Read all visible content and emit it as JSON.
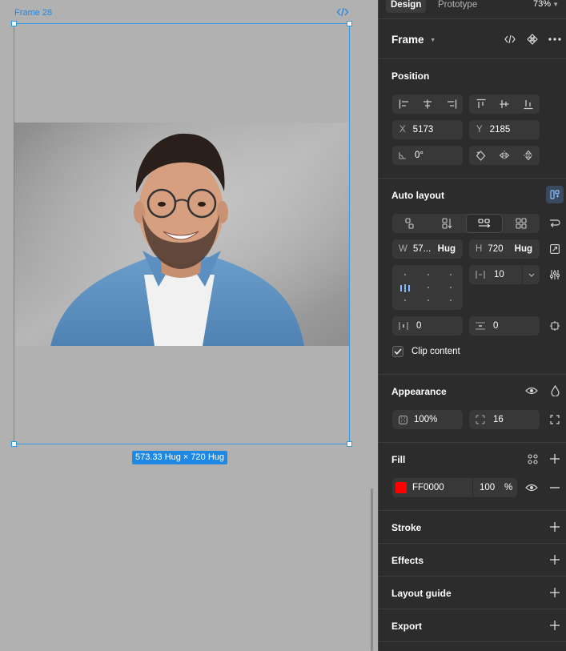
{
  "canvas": {
    "frame_label": "Frame 28",
    "size_badge": "573.33 Hug × 720 Hug"
  },
  "panel": {
    "tabs": {
      "design": "Design",
      "prototype": "Prototype",
      "zoom": "73%"
    },
    "header": {
      "title": "Frame"
    },
    "position": {
      "title": "Position",
      "x_label": "X",
      "x_value": "5173",
      "y_label": "Y",
      "y_value": "2185",
      "rotation": "0°"
    },
    "auto_layout": {
      "title": "Auto layout",
      "w_label": "W",
      "w_value": "57...",
      "w_mode": "Hug",
      "h_label": "H",
      "h_value": "720",
      "h_mode": "Hug",
      "gap": "10",
      "padding_h": "0",
      "padding_v": "0",
      "clip_content": "Clip content"
    },
    "appearance": {
      "title": "Appearance",
      "opacity": "100%",
      "radius": "16"
    },
    "fill": {
      "title": "Fill",
      "hex": "FF0000",
      "opacity": "100",
      "percent": "%",
      "color": "#ff0000"
    },
    "stroke": {
      "title": "Stroke"
    },
    "effects": {
      "title": "Effects"
    },
    "layout_guide": {
      "title": "Layout guide"
    },
    "export": {
      "title": "Export"
    }
  },
  "colors": {
    "selection": "#2d9cdb",
    "accent": "#1e88e5",
    "panel_bg": "#2c2c2c",
    "canvas_bg": "#b1b1b1"
  }
}
